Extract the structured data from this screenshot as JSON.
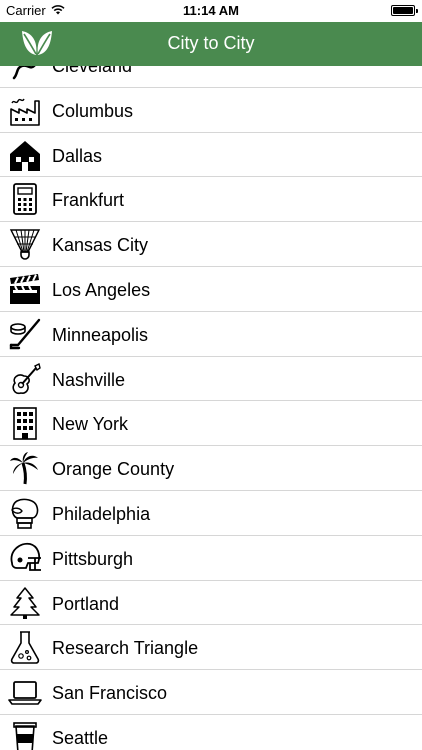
{
  "status_bar": {
    "carrier": "Carrier",
    "time": "11:14 AM"
  },
  "nav": {
    "title": "City to City",
    "logo_icon": "leaf-logo-icon"
  },
  "colors": {
    "nav_background": "#4a8a4f",
    "separator": "#d6d6d6"
  },
  "cities": [
    {
      "label": "Cleveland",
      "icon": "guitar-cable-icon"
    },
    {
      "label": "Columbus",
      "icon": "factory-icon"
    },
    {
      "label": "Dallas",
      "icon": "house-icon"
    },
    {
      "label": "Frankfurt",
      "icon": "calculator-icon"
    },
    {
      "label": "Kansas City",
      "icon": "shuttlecock-icon"
    },
    {
      "label": "Los Angeles",
      "icon": "clapperboard-icon"
    },
    {
      "label": "Minneapolis",
      "icon": "hockey-stick-puck-icon"
    },
    {
      "label": "Nashville",
      "icon": "guitar-icon"
    },
    {
      "label": "New York",
      "icon": "office-building-icon"
    },
    {
      "label": "Orange County",
      "icon": "palm-tree-icon"
    },
    {
      "label": "Philadelphia",
      "icon": "boxing-glove-icon"
    },
    {
      "label": "Pittsburgh",
      "icon": "football-helmet-icon"
    },
    {
      "label": "Portland",
      "icon": "pine-tree-icon"
    },
    {
      "label": "Research Triangle",
      "icon": "flask-icon"
    },
    {
      "label": "San Francisco",
      "icon": "laptop-icon"
    },
    {
      "label": "Seattle",
      "icon": "coffee-cup-icon"
    }
  ]
}
